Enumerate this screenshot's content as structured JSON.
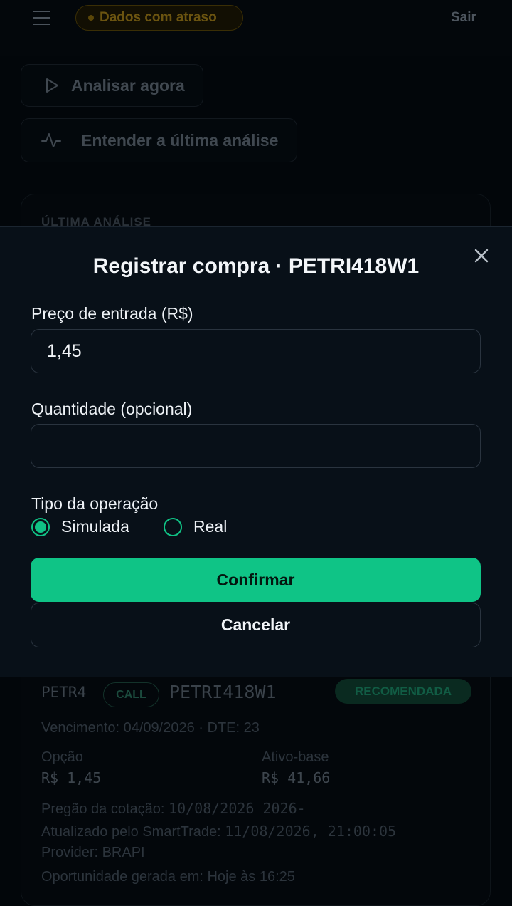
{
  "topbar": {
    "status_badge": "Dados com atraso",
    "logout_label": "Sair"
  },
  "actions": {
    "analyze_label": "Analisar agora",
    "understand_label": "Entender a última análise"
  },
  "card": {
    "heading": "ÚLTIMA ANÁLISE",
    "underlying_ticker": "PETR4",
    "option_type": "CALL",
    "option_code": "PETRI418W1",
    "recommendation": "RECOMENDADA",
    "expiry_line": "Vencimento: 04/09/2026 · DTE: 23",
    "option_label": "Opção",
    "option_price": "R$ 1,45",
    "underlying_label": "Ativo-base",
    "underlying_price": "R$ 41,66",
    "quote_session_label": "Pregão da cotação:",
    "quote_session_value": "10/08/2026 2026-",
    "updated_label": "Atualizado pelo SmartTrade:",
    "updated_value": "11/08/2026, 21:00:05",
    "provider_line": "Provider: BRAPI",
    "generated_line": "Oportunidade gerada em: Hoje às 16:25"
  },
  "modal": {
    "title": "Registrar compra · PETRI418W1",
    "price_label": "Preço de entrada (R$)",
    "price_value": "1,45",
    "quantity_label": "Quantidade (opcional)",
    "quantity_value": "",
    "operation_label": "Tipo da operação",
    "options": [
      {
        "label": "Simulada",
        "checked": true
      },
      {
        "label": "Real",
        "checked": false
      }
    ],
    "confirm_label": "Confirmar",
    "cancel_label": "Cancelar"
  },
  "colors": {
    "accent": "#0fc486",
    "modal_bg": "#081018",
    "page_bg": "#02060a"
  }
}
